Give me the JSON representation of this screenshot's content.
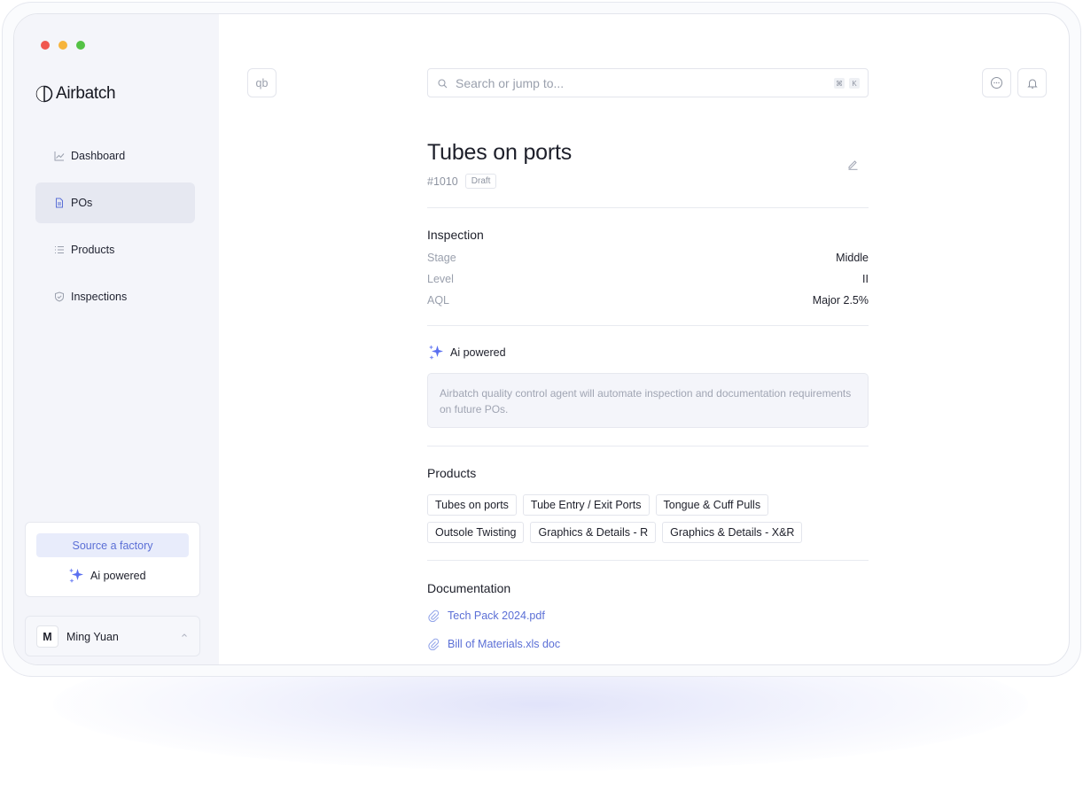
{
  "window": {
    "traffic_lights": [
      {
        "name": "close",
        "color": "#f0574f"
      },
      {
        "name": "minimize",
        "color": "#f6b43c"
      },
      {
        "name": "maximize",
        "color": "#54c245"
      }
    ]
  },
  "sidebar": {
    "logo_text": "Airbatch",
    "items": [
      {
        "label": "Dashboard",
        "icon": "chart-line-icon",
        "active": false
      },
      {
        "label": "POs",
        "icon": "document-icon",
        "active": true
      },
      {
        "label": "Products",
        "icon": "list-icon",
        "active": false
      },
      {
        "label": "Inspections",
        "icon": "shield-check-icon",
        "active": false
      }
    ],
    "source_button": "Source a factory",
    "ai_label": "Ai powered",
    "user": {
      "initial": "M",
      "name": "Ming Yuan"
    }
  },
  "topbar": {
    "qb_label": "qb",
    "search_placeholder": "Search or jump to...",
    "shortcut_keys": [
      "⌘",
      "K"
    ],
    "right_icons": [
      "chat-icon",
      "bell-icon"
    ]
  },
  "po": {
    "title": "Tubes on ports",
    "id": "#1010",
    "status": "Draft"
  },
  "inspection": {
    "heading": "Inspection",
    "rows": [
      {
        "key": "Stage",
        "value": "Middle"
      },
      {
        "key": "Level",
        "value": "II"
      },
      {
        "key": "AQL",
        "value": "Major 2.5%"
      }
    ]
  },
  "ai": {
    "label": "Ai powered",
    "message": "Airbatch quality control agent will automate inspection and documentation requirements on future POs."
  },
  "products": {
    "heading": "Products",
    "tags": [
      "Tubes on ports",
      "Tube Entry / Exit Ports",
      "Tongue & Cuff Pulls",
      "Outsole Twisting",
      "Graphics & Details - R",
      "Graphics & Details - X&R"
    ]
  },
  "documentation": {
    "heading": "Documentation",
    "files": [
      "Tech Pack 2024.pdf",
      "Bill of Materials.xls doc"
    ]
  },
  "colors": {
    "accent": "#5b6fd6",
    "sidebar_bg": "#f4f5fa",
    "sparkle": "#5a6ff0"
  }
}
